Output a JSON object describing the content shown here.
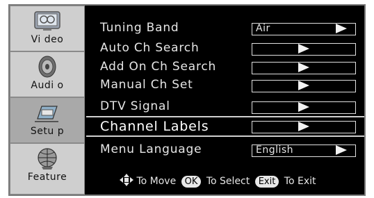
{
  "sidebar": {
    "items": [
      {
        "label": "Vi deo",
        "icon": "video-icon"
      },
      {
        "label": "Audi o",
        "icon": "speaker-icon"
      },
      {
        "label": "Setu p",
        "icon": "setup-icon"
      },
      {
        "label": "Feature",
        "icon": "globe-feature-icon"
      }
    ]
  },
  "menu": {
    "rows": [
      {
        "label": "Tuning  Band",
        "value": "Air"
      },
      {
        "label": "Auto Ch Search",
        "value": ""
      },
      {
        "label": "Add On Ch Search",
        "value": ""
      },
      {
        "label": "Manual  Ch Set",
        "value": ""
      },
      {
        "label": "DTV Signal",
        "value": ""
      },
      {
        "label": "Channel  Labels",
        "value": ""
      },
      {
        "label": "Menu  Language",
        "value": "English"
      }
    ]
  },
  "footer": {
    "move_text": "To Move",
    "ok_key": "OK",
    "select_text": "To Select",
    "exit_key": "Exit",
    "exit_text": "To Exit"
  }
}
